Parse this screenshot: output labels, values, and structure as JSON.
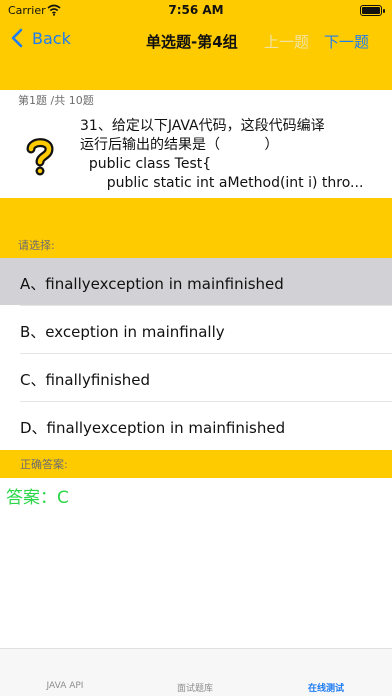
{
  "status_bar": {
    "carrier": "Carrier",
    "time": "7:56 AM"
  },
  "nav": {
    "back_label": "Back",
    "title": "单选题-第4组",
    "prev_label": "上一题",
    "next_label": "下一题"
  },
  "question": {
    "counter": "第1题 /共 10题",
    "lines": [
      "31、给定以下JAVA代码，这段代码编译",
      "运行后输出的结果是（          ）",
      "  public class Test{",
      "      public static int aMethod(int i) thro..."
    ]
  },
  "choose_label": "请选择:",
  "options": [
    {
      "label": "A、finallyexception in mainfinished",
      "selected": true
    },
    {
      "label": "B、exception in mainfinally",
      "selected": false
    },
    {
      "label": "C、finallyfinished",
      "selected": false
    },
    {
      "label": "D、finallyexception in mainfinished",
      "selected": false
    }
  ],
  "answer": {
    "label": "正确答案:",
    "value": "答案：C"
  },
  "tabs": [
    {
      "label": "JAVA API",
      "active": false
    },
    {
      "label": "面试题库",
      "active": false
    },
    {
      "label": "在线测试",
      "active": true
    }
  ],
  "colors": {
    "accent": "#fecb00",
    "link": "#1e7cf2",
    "answer": "#2bd64a",
    "selected_row": "#d2d1d5"
  },
  "icons": [
    "wifi-icon",
    "battery-icon",
    "back-chevron-icon",
    "question-mark-icon"
  ]
}
